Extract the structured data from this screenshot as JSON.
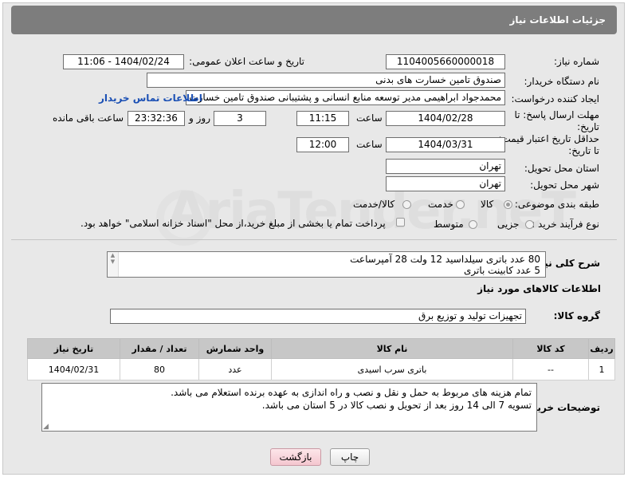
{
  "header": {
    "title": "جزئیات اطلاعات نیاز"
  },
  "fields": {
    "need_number_label": "شماره نیاز:",
    "need_number": "1104005660000018",
    "announce_label": "تاریخ و ساعت اعلان عمومی:",
    "announce_value": "1404/02/24 - 11:06",
    "buyer_org_label": "نام دستگاه خریدار:",
    "buyer_org": "صندوق تامین خسارت های بدنی",
    "creator_label": "ایجاد کننده درخواست:",
    "creator": "محمدجواد ابراهیمی مدیر توسعه منابع انسانی و پشتیبانی صندوق تامین خسارت",
    "contact_link": "اطلاعات تماس خریدار",
    "deadline_label_1": "مهلت ارسال پاسخ: تا",
    "deadline_label_2": "تاریخ:",
    "deadline_date": "1404/02/28",
    "time_label": "ساعت",
    "deadline_time": "11:15",
    "days_value": "3",
    "days_label": "روز و",
    "remaining_value": "23:32:36",
    "remaining_label": "ساعت باقی مانده",
    "validity_label_1": "حداقل تاریخ اعتبار قیمت:",
    "validity_label_2": "تا تاریخ:",
    "validity_date": "1404/03/31",
    "validity_time": "12:00",
    "province_label": "استان محل تحویل:",
    "province": "تهران",
    "city_label": "شهر محل تحویل:",
    "city": "تهران",
    "category_label": "طبقه بندی موضوعی:",
    "category_options": [
      "کالا",
      "خدمت",
      "کالا/خدمت"
    ],
    "process_label": "نوع فرآیند خرید :",
    "process_options": [
      "جزیی",
      "متوسط"
    ],
    "payment_note": "پرداخت تمام یا بخشی از مبلغ خرید،از محل \"اسناد خزانه اسلامی\" خواهد بود."
  },
  "description": {
    "label": "شرح کلی نیاز:",
    "line1": "80 عدد باتری   سیلداسید 12 ولت 28 آمپرساعت",
    "line2": "5 عدد کابینت باتری"
  },
  "goods": {
    "section_title": "اطلاعات کالاهای مورد نیاز",
    "group_label": "گروه کالا:",
    "group_value": "تجهیزات تولید و توزیع برق",
    "columns": [
      "ردیف",
      "کد کالا",
      "نام کالا",
      "واحد شمارش",
      "تعداد / مقدار",
      "تاریخ نیاز"
    ],
    "rows": [
      {
        "row": "1",
        "code": "--",
        "name": "باتری سرب اسیدی",
        "unit": "عدد",
        "qty": "80",
        "date": "1404/02/31"
      }
    ]
  },
  "buyer_notes": {
    "label": "توضیحات خریدار:",
    "line1": "تمام هزینه های مربوط به حمل و نقل و نصب و راه اندازی به عهده برنده استعلام می باشد.",
    "line2": "تسویه 7 الی 14 روز بعد از تحویل و نصب کالا در 5 استان می باشد."
  },
  "buttons": {
    "print": "چاپ",
    "back": "بازگشت"
  },
  "watermark": "AriaTender.neT"
}
